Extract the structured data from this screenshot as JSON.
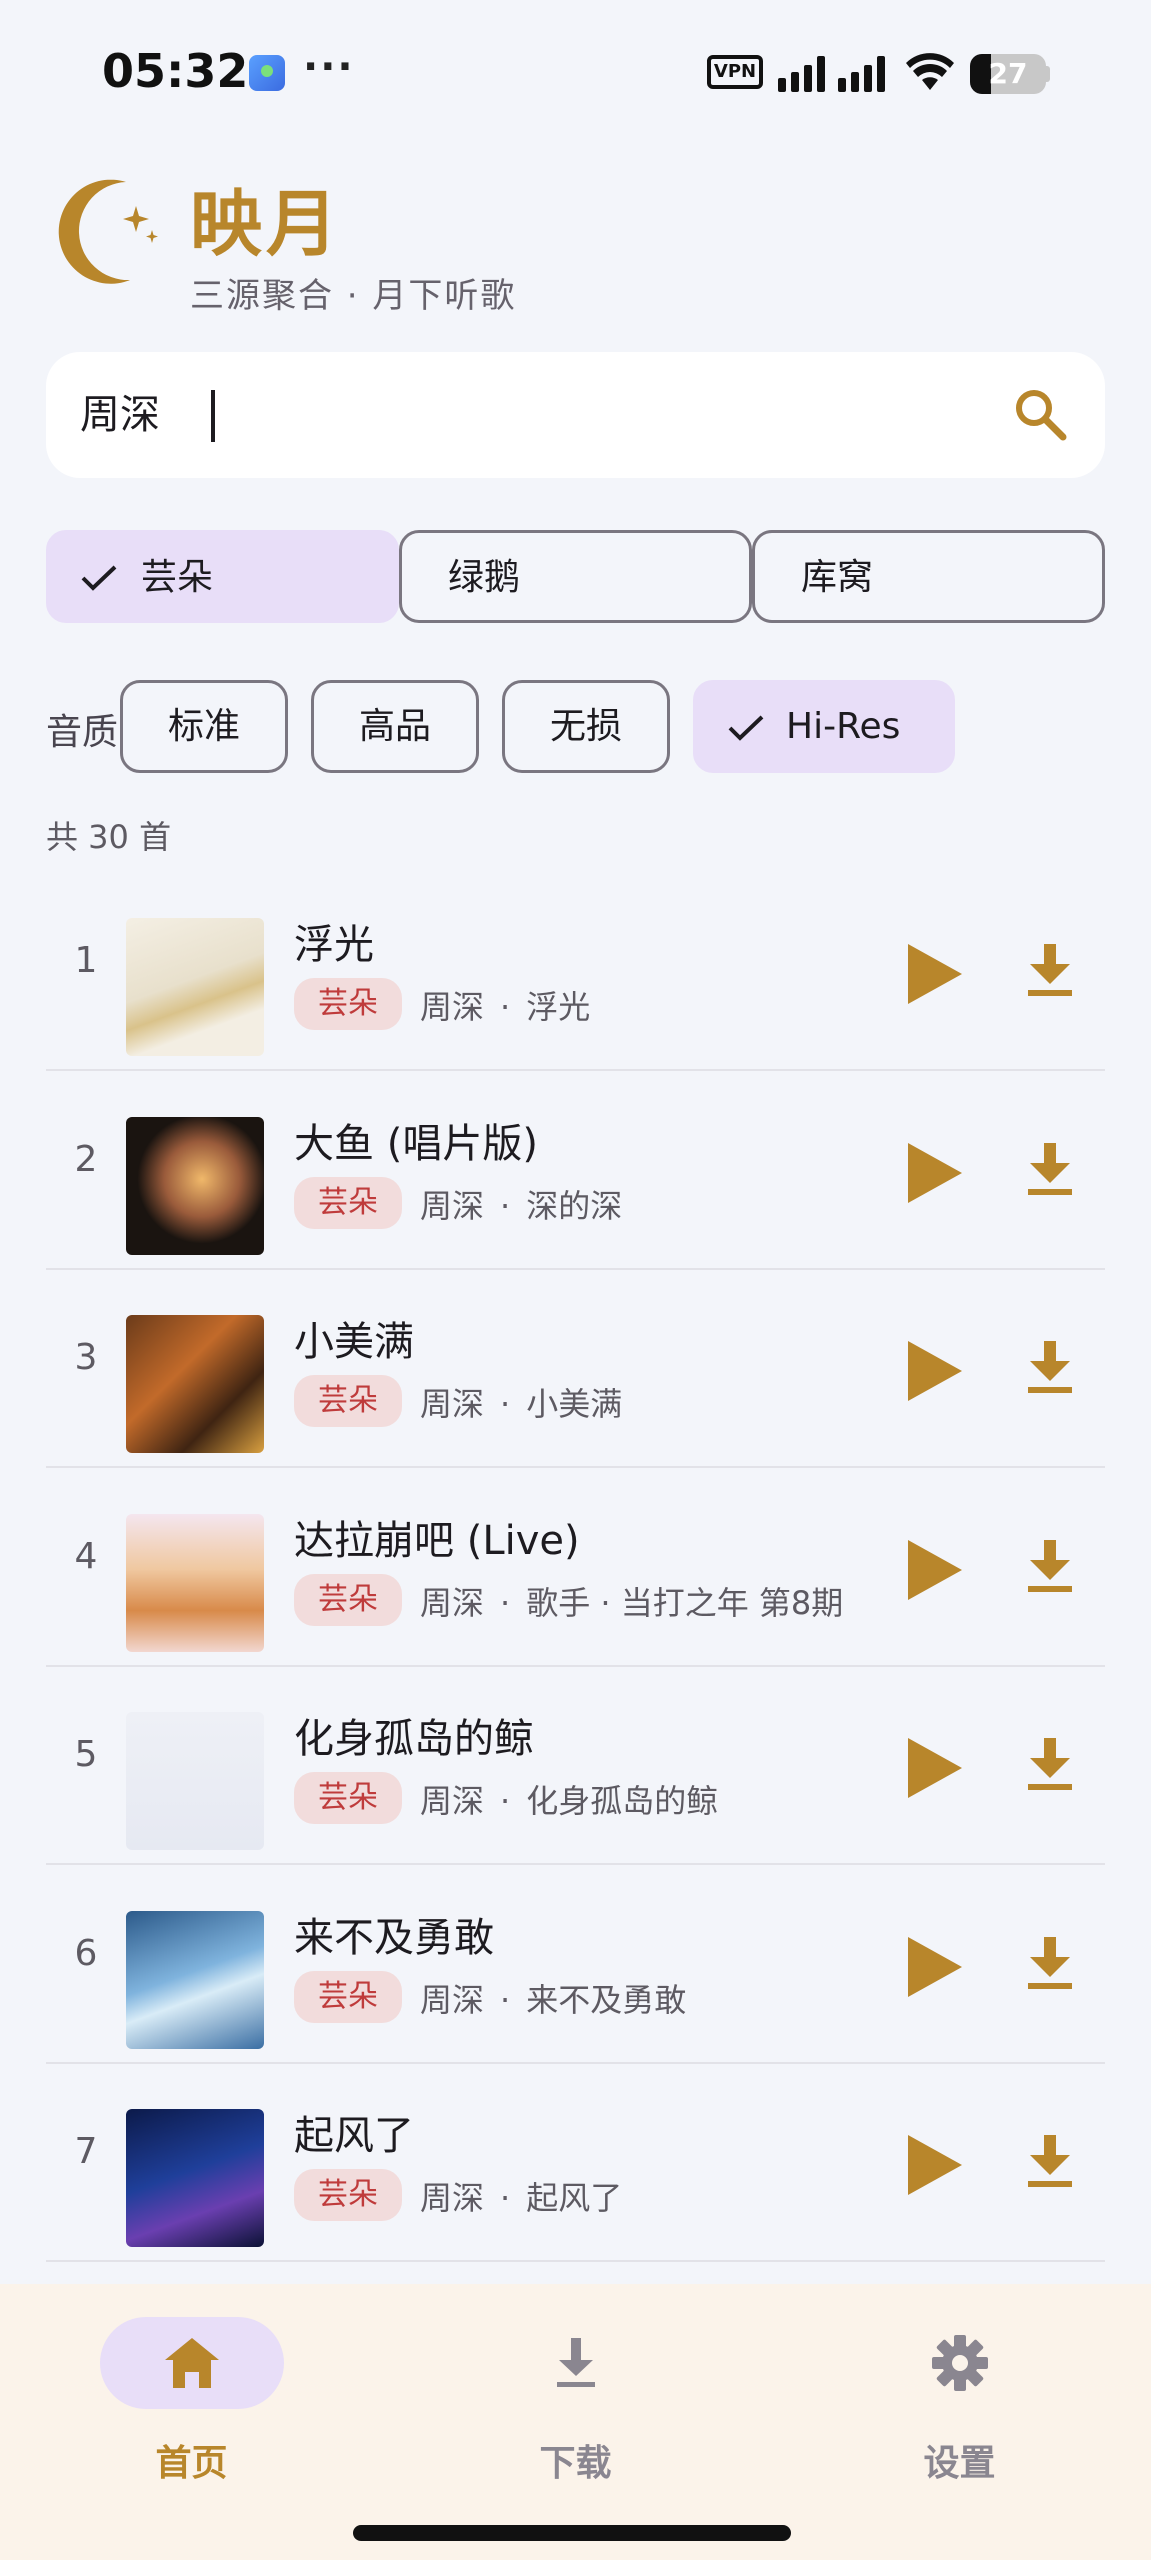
{
  "status_bar": {
    "time": "05:32",
    "dots": "···",
    "vpn": "VPN",
    "battery": "27",
    "battery_level": 0.27
  },
  "brand": {
    "title": "映月",
    "subtitle": "三源聚合 · 月下听歌"
  },
  "search": {
    "value": "周深",
    "icon": "search-icon"
  },
  "sources": [
    {
      "label": "芸朵",
      "selected": true
    },
    {
      "label": "绿鹅",
      "selected": false
    },
    {
      "label": "库窝",
      "selected": false
    }
  ],
  "quality": {
    "label": "音质",
    "options": [
      {
        "label": "标准",
        "selected": false
      },
      {
        "label": "高品",
        "selected": false
      },
      {
        "label": "无损",
        "selected": false
      },
      {
        "label": "Hi-Res",
        "selected": true
      }
    ]
  },
  "results": {
    "count_text": "共 30 首",
    "songs": [
      {
        "index": "1",
        "title": "浮光",
        "source": "芸朵",
        "artist": "周深",
        "separator": "·",
        "album": "浮光"
      },
      {
        "index": "2",
        "title": "大鱼 (唱片版)",
        "source": "芸朵",
        "artist": "周深",
        "separator": "·",
        "album": "深的深"
      },
      {
        "index": "3",
        "title": "小美满",
        "source": "芸朵",
        "artist": "周深",
        "separator": "·",
        "album": "小美满"
      },
      {
        "index": "4",
        "title": "达拉崩吧 (Live)",
        "source": "芸朵",
        "artist": "周深",
        "separator": "·",
        "album": "歌手 · 当打之年 第8期"
      },
      {
        "index": "5",
        "title": "化身孤岛的鲸",
        "source": "芸朵",
        "artist": "周深",
        "separator": "·",
        "album": "化身孤岛的鲸"
      },
      {
        "index": "6",
        "title": "来不及勇敢",
        "source": "芸朵",
        "artist": "周深",
        "separator": "·",
        "album": "来不及勇敢"
      },
      {
        "index": "7",
        "title": "起风了",
        "source": "芸朵",
        "artist": "周深",
        "separator": "·",
        "album": "起风了"
      }
    ]
  },
  "nav": {
    "items": [
      {
        "label": "首页",
        "icon": "home-icon",
        "active": true
      },
      {
        "label": "下载",
        "icon": "download-icon",
        "active": false
      },
      {
        "label": "设置",
        "icon": "gear-icon",
        "active": false
      }
    ]
  },
  "colors": {
    "accent": "#B8862B",
    "chip_selected": "#E8DEF8",
    "source_badge_bg": "#F2DCDC",
    "source_badge_text": "#BF3B3B",
    "background": "#F3F5FA",
    "nav_background": "#FBF3EA"
  }
}
